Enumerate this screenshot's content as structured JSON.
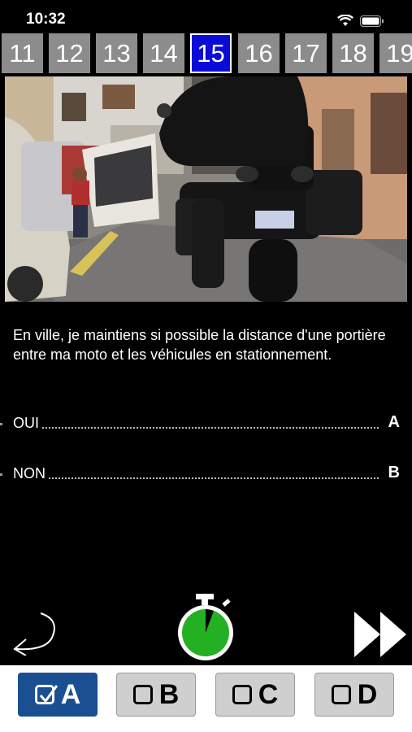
{
  "status": {
    "time": "10:32"
  },
  "tabs": [
    {
      "label": "11",
      "active": false
    },
    {
      "label": "12",
      "active": false
    },
    {
      "label": "13",
      "active": false
    },
    {
      "label": "14",
      "active": false
    },
    {
      "label": "15",
      "active": true
    },
    {
      "label": "16",
      "active": false
    },
    {
      "label": "17",
      "active": false
    },
    {
      "label": "18",
      "active": false
    },
    {
      "label": "19",
      "active": false
    }
  ],
  "question": "En ville, je maintiens si possible la distance d'une portière entre ma moto et les véhicules en stationnement.",
  "answers": [
    {
      "text": "OUI",
      "letter": "A"
    },
    {
      "text": "NON",
      "letter": "B"
    }
  ],
  "choices": [
    {
      "letter": "A",
      "selected": true
    },
    {
      "letter": "B",
      "selected": false
    },
    {
      "letter": "C",
      "selected": false
    },
    {
      "letter": "D",
      "selected": false
    }
  ],
  "icons": {
    "back": "back-arrow-icon",
    "timer": "stopwatch-icon",
    "next": "fast-forward-icon",
    "wifi": "wifi-icon",
    "battery": "battery-icon"
  },
  "colors": {
    "active_tab": "#0b0bd8",
    "selected_choice": "#1a4f91",
    "timer": "#23b023"
  }
}
